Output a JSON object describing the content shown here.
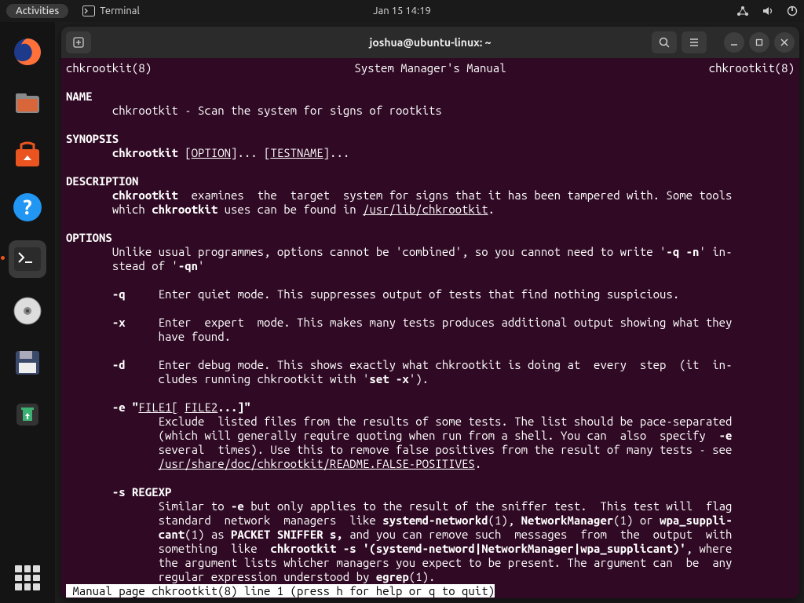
{
  "topbar": {
    "activities": "Activities",
    "app_label": "Terminal",
    "clock": "Jan 15  14:19"
  },
  "window": {
    "title": "joshua@ubuntu-linux: ~"
  },
  "man": {
    "header_left": "chkrootkit(8)",
    "header_center": "System Manager's Manual",
    "header_right": "chkrootkit(8)",
    "sec_name": "NAME",
    "name_line": "chkrootkit - Scan the system for signs of rootkits",
    "sec_synopsis": "SYNOPSIS",
    "syn_cmd": "chkrootkit",
    "syn_opt": "OPTION",
    "syn_test": "TESTNAME",
    "sec_desc": "DESCRIPTION",
    "desc_b1": "chkrootkit",
    "desc_t1": "  examines  the  target  system for signs that it has been tampered with. Some tools",
    "desc_t2": "which ",
    "desc_b2": "chkrootkit",
    "desc_t3": " uses can be found in ",
    "desc_u1": "/usr/lib/chkrootkit",
    "sec_options": "OPTIONS",
    "opt_intro1": "Unlike usual programmes, options cannot be 'combined', so you cannot need to write '",
    "opt_b_qn1": "-q -n",
    "opt_intro2": "' in‐",
    "opt_intro3": "stead of '",
    "opt_b_qn2": "-qn",
    "opt_intro4": "'",
    "q_flag": "-q",
    "q_desc": "Enter quiet mode. This suppresses output of tests that find nothing suspicious.",
    "x_flag": "-x",
    "x_desc1": "Enter  expert  mode. This makes many tests produces additional output showing what they",
    "x_desc2": "have found.",
    "d_flag": "-d",
    "d_desc1": "Enter debug mode. This shows exactly what chkrootkit is doing at  every  step  (it  in‐",
    "d_desc2": "cludes running chkrootkit with '",
    "d_setx": "set -x",
    "d_desc3": "').",
    "e_flag": "-e \"",
    "e_u1": "FILE1[",
    "e_u2": "FILE2",
    "e_tail": "...]\"",
    "e_desc1": "Exclude  listed files from the results of some tests. The list should be pace-separated",
    "e_desc2": "(which will generally require quoting when run from a shell. You can  also  specify  ",
    "e_b": "-e",
    "e_desc3": "several  times). Use this to remove false positives from the result of many tests - see",
    "e_path": "/usr/share/doc/chkrootkit/README.FALSE-POSITIVES",
    "s_flag": "-s REGEXP",
    "s_desc1a": "Similar to ",
    "s_b_e": "-e",
    "s_desc1b": " but only applies to the result of the sniffer test.  This test will  flag",
    "s_desc2a": "standard  network  managers  like ",
    "s_b_sn": "systemd-networkd",
    "s_desc2b": "(1), ",
    "s_b_nm": "NetworkManager",
    "s_desc2c": "(1) or ",
    "s_b_wp": "wpa_suppli‐",
    "s_b_wp2": "cant",
    "s_desc3a": "(1) as ",
    "s_b_ps": "PACKET SNIFFER s,",
    "s_desc3b": " and you can remove such  messages  from  the  output  with",
    "s_desc4a": "something  like  ",
    "s_b_cmd": "chkrootkit -s '(systemd-netword|NetworkManager|wpa_supplicant)'",
    "s_desc4b": ", where",
    "s_desc5": "the argument lists whicher managers you expect to be present. The argument can  be  any",
    "s_desc6a": "regular expression understood by ",
    "s_b_eg": "egrep",
    "s_desc6b": "(1).",
    "statusline": " Manual page chkrootkit(8) line 1 (press h for help or q to quit)"
  }
}
